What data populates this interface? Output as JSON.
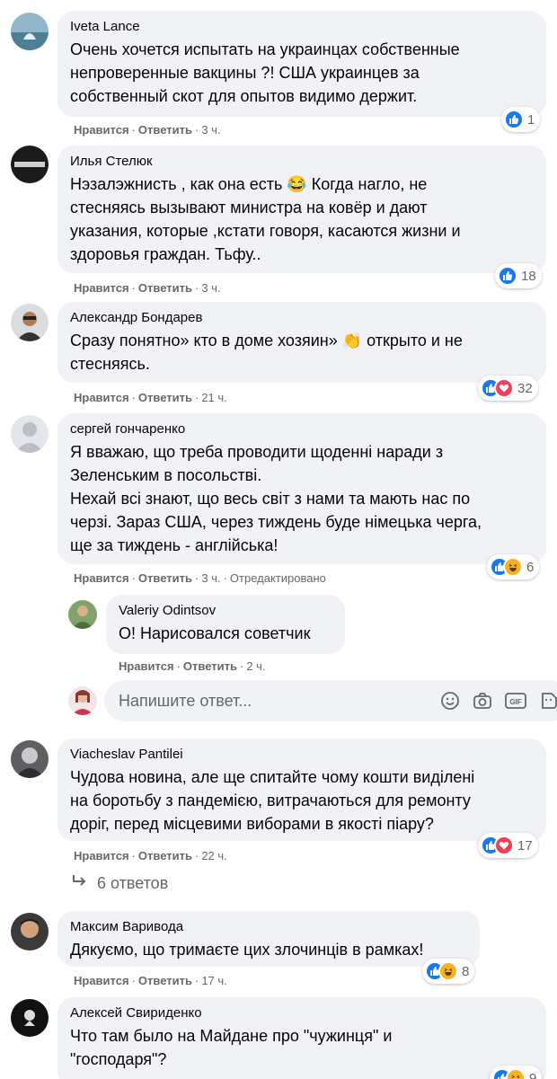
{
  "actions": {
    "like": "Нравится",
    "reply": "Ответить",
    "dot": "·"
  },
  "comments": [
    {
      "author": "Iveta Lance",
      "text": "Очень хочется испытать на украинцах собственные\nнепроверенные вакцины ?! США украинцев за\nсобственный скот для опытов видимо держит.",
      "time": "3 ч.",
      "reactions": "1"
    },
    {
      "author": "Илья Стелюк",
      "text": "Нэзалэжнисть , как она есть 😂 Когда нагло, не\nстесняясь вызывают министра на ковёр и дают\nуказания, которые ,кстати говоря, касаются жизни и\nздоровья граждан. Тьфу..",
      "time": "3 ч.",
      "reactions": "18"
    },
    {
      "author": "Александр Бондарев",
      "text": "Сразу понятно» кто в доме хозяин» 👏 открыто и не\nстесняясь.",
      "time": "21 ч.",
      "reactions": "32"
    },
    {
      "author": "сергей гончаренко",
      "text": "Я вважаю, що треба проводити щоденні наради з\nЗеленським в посольстві.\nНехай всі знают, що весь світ з нами та мають нас по\nчерзі. Зараз США, через тиждень буде німецька черга,\nще за тиждень - англійська!",
      "time": "3 ч.",
      "edited": "Отредактировано",
      "reactions": "6"
    },
    {
      "author": "Viacheslav Pantilei",
      "text": "Чудова новина, але ще спитайте чому кошти виділені\nна боротьбу з пандемією, витрачаються для ремонту\nдоріг, перед місцевими виборами в якості піару?",
      "time": "22 ч.",
      "reactions": "17"
    },
    {
      "author": "Максим Варивода",
      "text": "Дякуємо, що тримаєте цих злочинців в рамках!",
      "time": "17 ч.",
      "reactions": "8"
    },
    {
      "author": "Алексей Свириденко",
      "text": "Что там было на Майдане про \"чужинця\" и\n\"господаря\"?",
      "reactions": "9"
    }
  ],
  "reply": {
    "author": "Valeriy Odintsov",
    "text": "О! Нарисовался советчик",
    "time": "2 ч."
  },
  "reply_box": {
    "placeholder": "Напишите ответ..."
  },
  "replies_link": "6 ответов",
  "colors": {
    "bubble": "#f0f2f5",
    "meta": "#65676b",
    "like": "#1877f2",
    "love": "#f33e58",
    "haha": "#f7b125"
  },
  "icons": [
    "like-icon",
    "love-icon",
    "haha-icon",
    "emoji-icon",
    "camera-icon",
    "gif-icon",
    "sticker-icon",
    "reply-arrow-icon"
  ]
}
